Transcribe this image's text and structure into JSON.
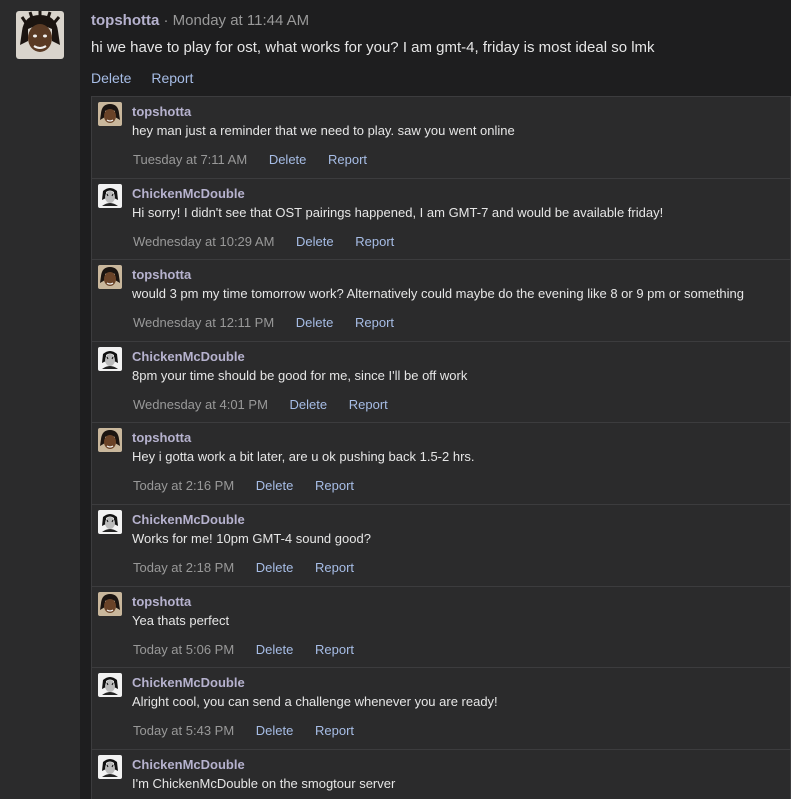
{
  "post": {
    "author": "topshotta",
    "separator": "·",
    "time": "Monday at 11:44 AM",
    "body": "hi we have to play for ost, what works for you? I am gmt-4, friday is most ideal so lmk",
    "actions": [
      "Delete",
      "Report"
    ]
  },
  "comments": [
    {
      "author": "topshotta",
      "avatar": "topshotta-avatar",
      "text": "hey man just a reminder that we need to play. saw you went online",
      "time": "Tuesday at 7:11 AM",
      "delete": "Delete",
      "report": "Report"
    },
    {
      "author": "ChickenMcDouble",
      "avatar": "chickenmcdouble-avatar",
      "text": "Hi sorry! I didn't see that OST pairings happened, I am GMT-7 and would be available friday!",
      "time": "Wednesday at 10:29 AM",
      "delete": "Delete",
      "report": "Report"
    },
    {
      "author": "topshotta",
      "avatar": "topshotta-avatar",
      "text": "would 3 pm my time tomorrow work? Alternatively could maybe do the evening like 8 or 9 pm or something",
      "time": "Wednesday at 12:11 PM",
      "delete": "Delete",
      "report": "Report"
    },
    {
      "author": "ChickenMcDouble",
      "avatar": "chickenmcdouble-avatar",
      "text": "8pm your time should be good for me, since I'll be off work",
      "time": "Wednesday at 4:01 PM",
      "delete": "Delete",
      "report": "Report"
    },
    {
      "author": "topshotta",
      "avatar": "topshotta-avatar",
      "text": "Hey i gotta work a bit later, are u ok pushing back 1.5-2 hrs.",
      "time": "Today at 2:16 PM",
      "delete": "Delete",
      "report": "Report"
    },
    {
      "author": "ChickenMcDouble",
      "avatar": "chickenmcdouble-avatar",
      "text": "Works for me! 10pm GMT-4 sound good?",
      "time": "Today at 2:18 PM",
      "delete": "Delete",
      "report": "Report"
    },
    {
      "author": "topshotta",
      "avatar": "topshotta-avatar",
      "text": "Yea thats perfect",
      "time": "Today at 5:06 PM",
      "delete": "Delete",
      "report": "Report"
    },
    {
      "author": "ChickenMcDouble",
      "avatar": "chickenmcdouble-avatar",
      "text": "Alright cool, you can send a challenge whenever you are ready!",
      "time": "Today at 5:43 PM",
      "delete": "Delete",
      "report": "Report"
    },
    {
      "author": "ChickenMcDouble",
      "avatar": "chickenmcdouble-avatar",
      "text": "I'm ChickenMcDouble on the smogtour server",
      "time": "",
      "delete": "",
      "report": ""
    }
  ],
  "colors": {
    "author": "#b6b2ce",
    "link": "#a7bde6",
    "meta": "#999999",
    "panel": "#2b2b2c",
    "main": "#1e1e1f"
  }
}
